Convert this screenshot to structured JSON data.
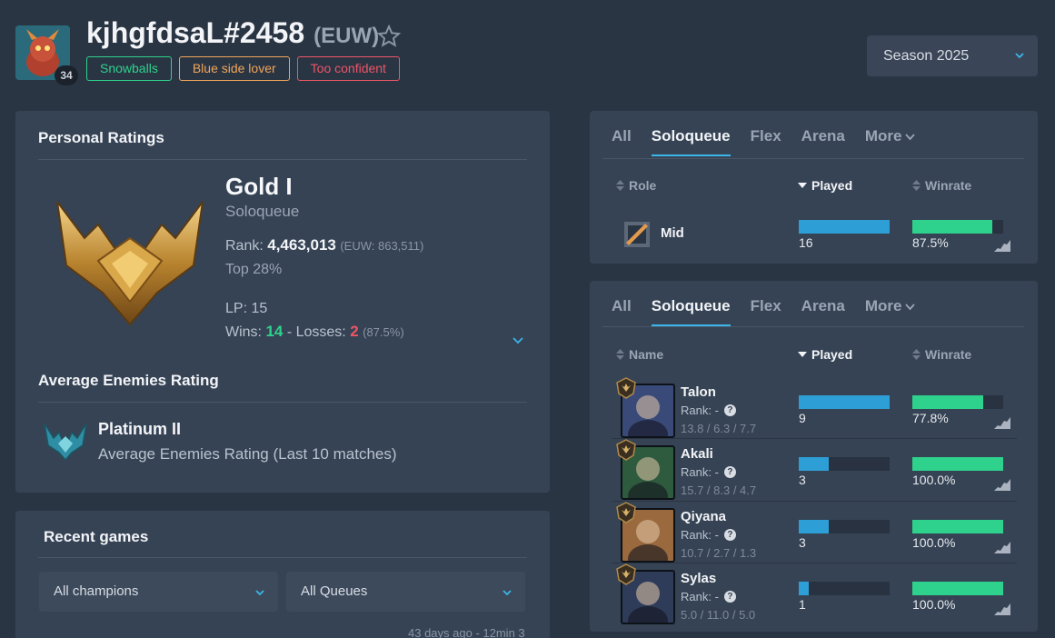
{
  "profile": {
    "name": "kjhgfdsaL#2458",
    "region": "(EUW)",
    "level": "34",
    "tags": [
      {
        "label": "Snowballs",
        "color": "#2ed28c"
      },
      {
        "label": "Blue side lover",
        "color": "#f0a55a"
      },
      {
        "label": "Too confident",
        "color": "#ee5566"
      }
    ],
    "favorite_icon": "star-outline-icon"
  },
  "season": {
    "selected": "Season 2025"
  },
  "personal_ratings": {
    "title": "Personal Ratings",
    "tier": "Gold I",
    "queue": "Soloqueue",
    "rank_label": "Rank:",
    "rank_value": "4,463,013",
    "rank_region": "(EUW: 863,511)",
    "top_percent": "Top 28%",
    "lp": "LP: 15",
    "wins_label": "Wins:",
    "wins": "14",
    "separator": "-",
    "losses_label": "Losses:",
    "losses": "2",
    "winrate": "(87.5%)"
  },
  "avg_enemies": {
    "title": "Average Enemies Rating",
    "tier": "Platinum II",
    "description": "Average Enemies Rating (Last 10 matches)"
  },
  "recent_games": {
    "title": "Recent games",
    "champion_filter": "All champions",
    "queue_filter": "All Queues",
    "last_game": "43 days ago - 12min 3"
  },
  "tabs": [
    "All",
    "Soloqueue",
    "Flex",
    "Arena",
    "More"
  ],
  "active_tab": "Soloqueue",
  "role_table": {
    "headers": {
      "role": "Role",
      "played": "Played",
      "winrate": "Winrate"
    },
    "rows": [
      {
        "role": "Mid",
        "played": "16",
        "played_fraction": 1.0,
        "winrate": "87.5%",
        "winrate_fraction": 0.875
      }
    ]
  },
  "champion_table": {
    "headers": {
      "name": "Name",
      "played": "Played",
      "winrate": "Winrate"
    },
    "rows": [
      {
        "name": "Talon",
        "rank": "Rank: -",
        "kda": "13.8  /  6.3  /  7.7",
        "played": "9",
        "played_fraction": 1.0,
        "winrate": "77.8%",
        "winrate_fraction": 0.778,
        "art": "#3a4a78"
      },
      {
        "name": "Akali",
        "rank": "Rank: -",
        "kda": "15.7  /  8.3  /  4.7",
        "played": "3",
        "played_fraction": 0.333,
        "winrate": "100.0%",
        "winrate_fraction": 1.0,
        "art": "#2e5a3e"
      },
      {
        "name": "Qiyana",
        "rank": "Rank: -",
        "kda": "10.7  /  2.7  /  1.3",
        "played": "3",
        "played_fraction": 0.333,
        "winrate": "100.0%",
        "winrate_fraction": 1.0,
        "art": "#9a6a3e"
      },
      {
        "name": "Sylas",
        "rank": "Rank: -",
        "kda": "5.0  /  11.0  /  5.0",
        "played": "1",
        "played_fraction": 0.111,
        "winrate": "100.0%",
        "winrate_fraction": 1.0,
        "art": "#2e3c5a"
      }
    ]
  },
  "colors": {
    "played_bar": "#2e9fd6",
    "winrate_bar": "#2ed28c",
    "accent": "#3bb6e8"
  }
}
